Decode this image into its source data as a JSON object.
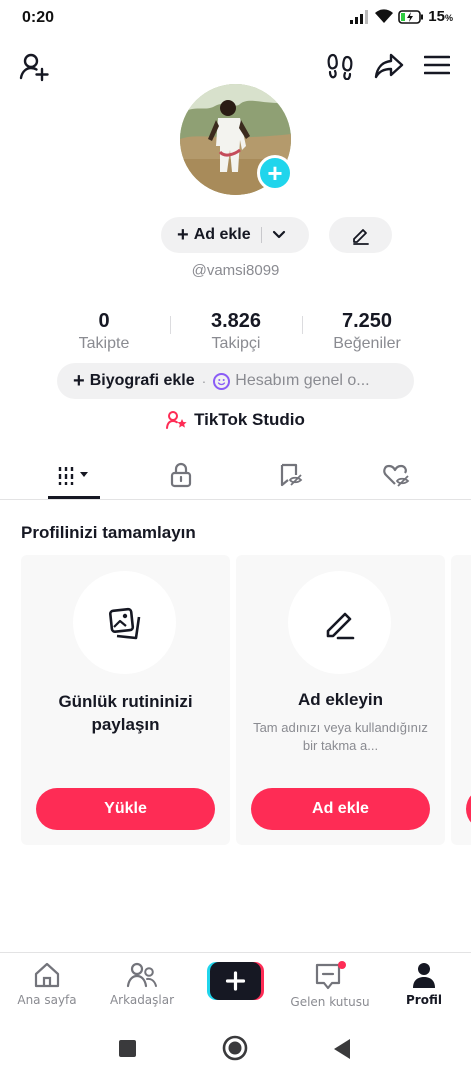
{
  "status_bar": {
    "time": "0:20",
    "battery": "15",
    "battery_unit": "%"
  },
  "profile": {
    "name_button": "Ad ekle",
    "username": "@vamsi8099",
    "stats": [
      {
        "value": "0",
        "label": "Takipte"
      },
      {
        "value": "3.826",
        "label": "Takipçi"
      },
      {
        "value": "7.250",
        "label": "Beğeniler"
      }
    ],
    "bio_button": "Biyografi ekle",
    "bio_separator": "·",
    "account_status": "Hesabım genel o...",
    "studio_label": "TikTok Studio"
  },
  "complete_section": {
    "title": "Profilinizi tamamlayın",
    "cards": [
      {
        "title": "Günlük rutininizi paylaşın",
        "subtitle": "",
        "button": "Yükle",
        "icon": "photos-icon"
      },
      {
        "title": "Ad ekleyin",
        "subtitle": "Tam adınızı veya kullandığınız bir takma a...",
        "button": "Ad ekle",
        "icon": "pencil-icon"
      }
    ]
  },
  "bottom_nav": [
    {
      "label": "Ana sayfa",
      "icon": "home-icon"
    },
    {
      "label": "Arkadaşlar",
      "icon": "friends-icon"
    },
    {
      "label": "Gelen kutusu",
      "icon": "inbox-icon"
    },
    {
      "label": "Profil",
      "icon": "profile-icon"
    }
  ],
  "colors": {
    "accent": "#fe2c55",
    "cyan": "#20d5ec",
    "text": "#161823",
    "muted": "#8a8b91",
    "pill": "#f1f1f2"
  }
}
